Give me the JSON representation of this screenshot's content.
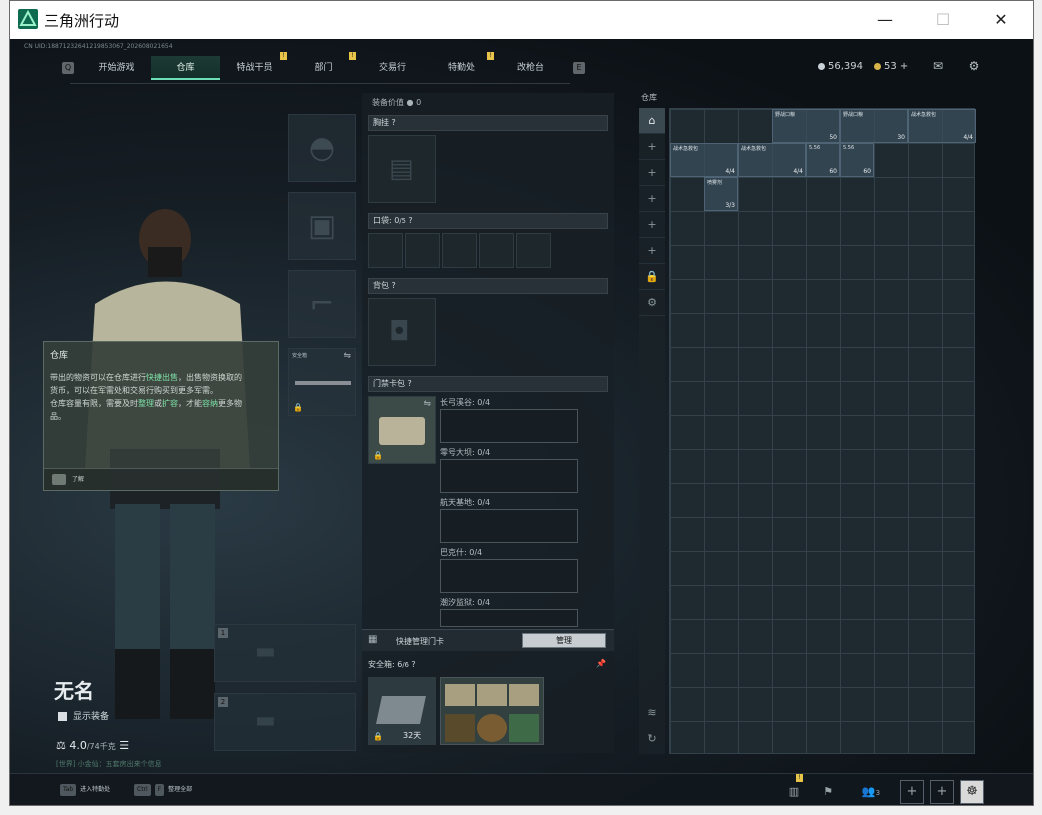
{
  "window": {
    "title": "三角洲行动",
    "minimize": "—",
    "maximize": "☐",
    "close": "✕"
  },
  "uid": "CN UID:1887123264121985306​7_20260802​1654",
  "nav": {
    "left_key": "Q",
    "right_key": "E",
    "tabs": [
      {
        "label": "开始游戏",
        "active": false,
        "badge": ""
      },
      {
        "label": "仓库",
        "active": true,
        "badge": ""
      },
      {
        "label": "特战干员",
        "active": false,
        "badge": "!"
      },
      {
        "label": "部门",
        "active": false,
        "badge": "!"
      },
      {
        "label": "交易行",
        "active": false,
        "badge": ""
      },
      {
        "label": "特勤处",
        "active": false,
        "badge": "!"
      },
      {
        "label": "改枪台",
        "active": false,
        "badge": ""
      }
    ]
  },
  "currency": {
    "havcoin": "56,394",
    "coupons": "53",
    "plus": "+"
  },
  "tooltip": {
    "title": "仓库",
    "line1_a": "带出的物资可以在仓库进行",
    "line1_hl": "快捷出售",
    "line1_b": "，出售物资换取的",
    "line2": "货币，可以在军需处和交易行购买到更多军需。",
    "line3_a": "仓库容量有限，需要及时",
    "line3_hl1": "整理",
    "line3_b": "或",
    "line3_hl2": "扩容",
    "line3_c": "，才能",
    "line3_hl3": "容纳",
    "line3_d": "更多物",
    "line4": "品。",
    "understood": "了解"
  },
  "character": {
    "name": "无名",
    "show_equip": "显示装备",
    "weight": "4.0",
    "weight_max": "/74千克",
    "hint": "[世界] 小金仙：五套房出来个信息"
  },
  "slots": {
    "secure_label": "安全箱",
    "weapon1": "1",
    "weapon2": "2"
  },
  "equip": {
    "value_label": "装备价值",
    "value": "0",
    "chest_rig": "胸挂",
    "pockets": "口袋: 0",
    "pockets_unit": "/5",
    "backpack": "背包",
    "keycard": "门禁卡包",
    "cards": [
      {
        "label": "长弓溪谷: 0/4"
      },
      {
        "label": "零号大坝: 0/4"
      },
      {
        "label": "航天基地: 0/4"
      },
      {
        "label": "巴克什: 0/4"
      },
      {
        "label": "潮汐监狱: 0/4"
      }
    ],
    "quick_manage": "快捷管理门卡",
    "manage_btn": "管理",
    "secure_box": "安全箱: 6",
    "secure_unit": "/6",
    "secure_days": "32天"
  },
  "storage": {
    "title": "仓库",
    "items": [
      {
        "label": "野战口粮",
        "count": "50",
        "col": 3,
        "row": 0,
        "w": 2,
        "h": 1
      },
      {
        "label": "野战口粮",
        "count": "30",
        "col": 5,
        "row": 0,
        "w": 2,
        "h": 1
      },
      {
        "label": "战术急救包",
        "count": "4/4",
        "col": 7,
        "row": 0,
        "w": 2,
        "h": 1
      },
      {
        "label": "战术急救包",
        "count": "4/4",
        "col": 0,
        "row": 1,
        "w": 2,
        "h": 1
      },
      {
        "label": "战术急救包",
        "count": "4/4",
        "col": 2,
        "row": 1,
        "w": 2,
        "h": 1
      },
      {
        "label": "5.56",
        "count": "60",
        "col": 4,
        "row": 1,
        "w": 1,
        "h": 1
      },
      {
        "label": "5.56",
        "count": "60",
        "col": 5,
        "row": 1,
        "w": 1,
        "h": 1
      },
      {
        "label": "喷雾剂",
        "count": "3/3",
        "col": 1,
        "row": 2,
        "w": 1,
        "h": 1
      }
    ]
  },
  "bottom": {
    "tab_key": "Tab",
    "tab_label": "进入特勤处",
    "ctrl_key": "Ctrl",
    "f_key": "F",
    "ctrl_label": "整理全部",
    "friends": "3",
    "notice_badge": "!"
  }
}
